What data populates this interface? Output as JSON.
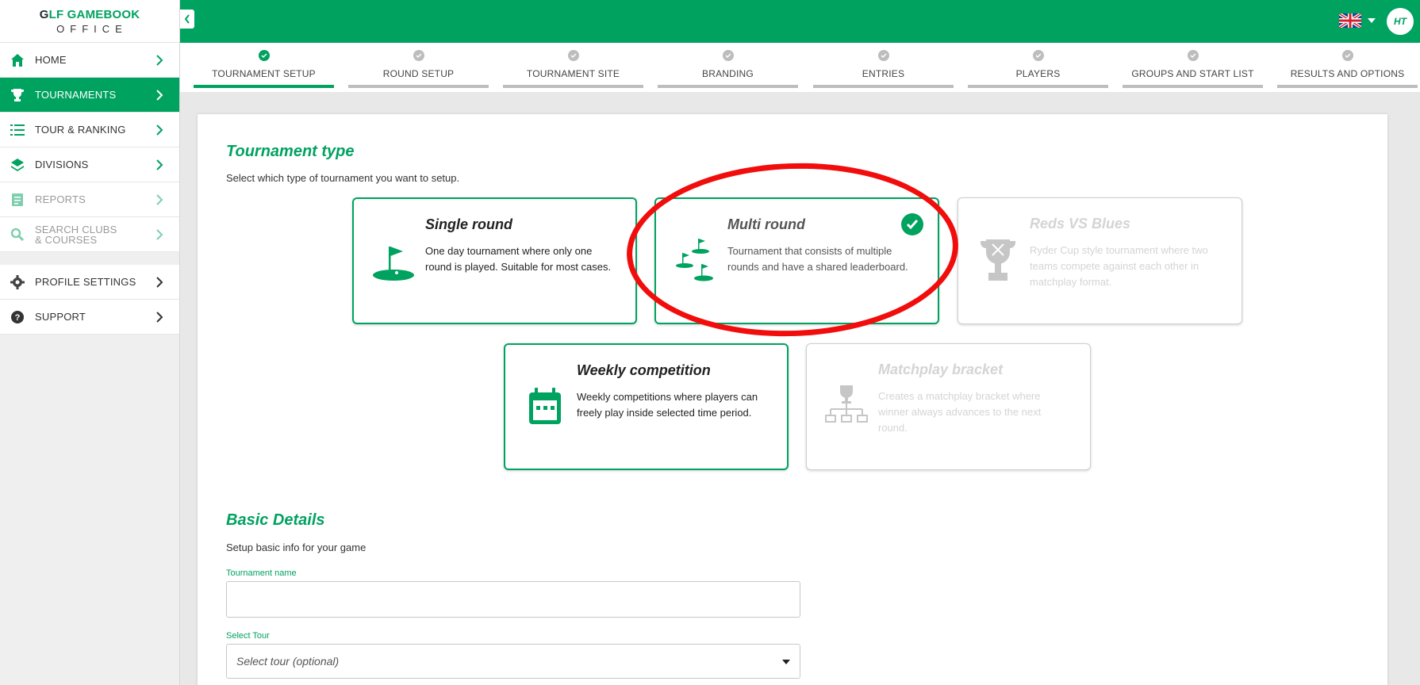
{
  "brand": {
    "logo_part1": "G",
    "logo_part2": "LF GAMEBOOK",
    "logo_sub": "OFFICE",
    "accent": "#00a260"
  },
  "sidebar": {
    "items": [
      {
        "label": "HOME"
      },
      {
        "label": "TOURNAMENTS"
      },
      {
        "label": "TOUR & RANKING"
      },
      {
        "label": "DIVISIONS"
      },
      {
        "label": "REPORTS"
      },
      {
        "label": "SEARCH CLUBS & COURSES"
      },
      {
        "label": "PROFILE SETTINGS"
      },
      {
        "label": "SUPPORT"
      }
    ]
  },
  "topbar": {
    "language": "en-GB",
    "avatar": "HT"
  },
  "stepper": {
    "steps": [
      {
        "label": "TOURNAMENT SETUP",
        "done": true
      },
      {
        "label": "ROUND SETUP",
        "done": false
      },
      {
        "label": "TOURNAMENT SITE",
        "done": false
      },
      {
        "label": "BRANDING",
        "done": false
      },
      {
        "label": "ENTRIES",
        "done": false
      },
      {
        "label": "PLAYERS",
        "done": false
      },
      {
        "label": "GROUPS AND START LIST",
        "done": false
      },
      {
        "label": "RESULTS AND OPTIONS",
        "done": false
      }
    ]
  },
  "tournament_type": {
    "title": "Tournament type",
    "subtitle": "Select which type of tournament you want to setup.",
    "cards": [
      {
        "title": "Single round",
        "desc": "One day tournament where only one round is played. Suitable for most cases.",
        "icon": "flag-icon"
      },
      {
        "title": "Multi round",
        "desc": "Tournament that consists of multiple rounds and have a shared leaderboard.",
        "icon": "multi-flag-icon",
        "selected": true
      },
      {
        "title": "Reds VS Blues",
        "desc": "Ryder Cup style tournament where two teams compete against each other in matchplay format.",
        "icon": "trophy-icon",
        "disabled": true
      },
      {
        "title": "Weekly competition",
        "desc": "Weekly competitions where players can freely play inside selected time period.",
        "icon": "calendar-icon"
      },
      {
        "title": "Matchplay bracket",
        "desc": "Creates a matchplay bracket where winner always advances to the next round.",
        "icon": "bracket-icon",
        "disabled": true
      }
    ]
  },
  "basic_details": {
    "title": "Basic Details",
    "subtitle": "Setup basic info for your game",
    "name_label": "Tournament name",
    "name_value": "",
    "tour_label": "Select Tour",
    "tour_placeholder": "Select tour (optional)"
  }
}
